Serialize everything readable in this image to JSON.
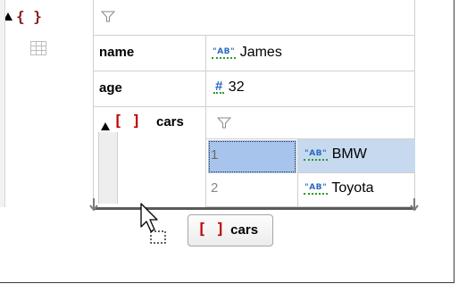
{
  "root": {
    "brace": "{ }",
    "fields": [
      {
        "key": "name",
        "type": "AB",
        "value": "James"
      },
      {
        "key": "age",
        "type": "#",
        "value": "32"
      }
    ]
  },
  "cars": {
    "bracket": "[ ]",
    "key": "cars",
    "rows": [
      {
        "index": "1",
        "type": "AB",
        "value": "BMW",
        "selected": true
      },
      {
        "index": "2",
        "type": "AB",
        "value": "Toyota",
        "selected": false
      }
    ]
  },
  "drag_tooltip": {
    "bracket": "[ ]",
    "label": "cars"
  },
  "colors": {
    "selection": "#c6d9ef",
    "index_selected": "#a7c4ec",
    "key_bracket": "#c00000",
    "brace": "#8b1a1a",
    "type_text": "#2a6ac2",
    "type_underline": "#2a9a2a"
  },
  "icons": [
    "collapse-triangle-icon",
    "table-view-icon",
    "filter-icon",
    "drag-cursor-icon",
    "resize-marker-icon"
  ]
}
